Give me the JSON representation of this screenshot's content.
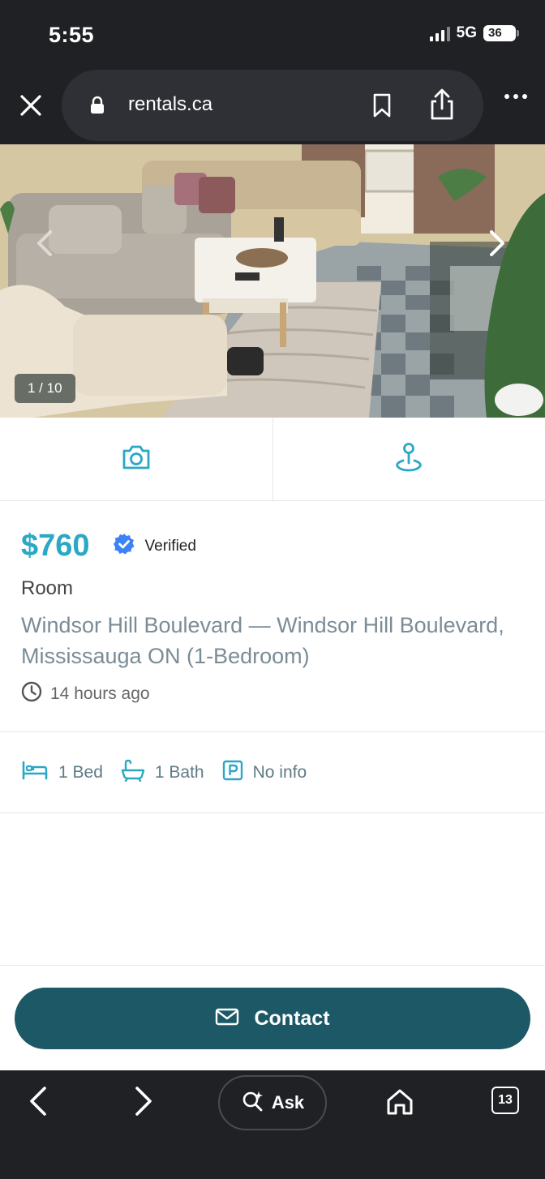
{
  "status_bar": {
    "time": "5:55",
    "network": "5G",
    "battery": "36"
  },
  "browser": {
    "url": "rentals.ca",
    "icons": [
      "close-icon",
      "lock-icon",
      "bookmark-icon",
      "share-icon",
      "more-icon"
    ]
  },
  "gallery": {
    "counter": "1 / 10",
    "icons": [
      "chevron-left-icon",
      "chevron-right-icon"
    ]
  },
  "actions": {
    "icons": [
      "camera-icon",
      "map-pin-icon"
    ]
  },
  "listing": {
    "price": "$760",
    "verified_label": "Verified",
    "type": "Room",
    "address": "Windsor Hill Boulevard — Windsor Hill Boulevard, Mississauga ON (1-Bedroom)",
    "posted": "14 hours ago"
  },
  "features": [
    {
      "icon": "bed-icon",
      "label": "1 Bed"
    },
    {
      "icon": "bath-icon",
      "label": "1 Bath"
    },
    {
      "icon": "parking-icon",
      "label": "No info"
    }
  ],
  "contact": {
    "label": "Contact"
  },
  "toolbar": {
    "ask_label": "Ask",
    "tab_count": "13"
  },
  "colors": {
    "accent": "#2aa8c4",
    "contact_button": "#1d5866",
    "chrome": "#202124",
    "verified_badge": "#3b82f6"
  }
}
